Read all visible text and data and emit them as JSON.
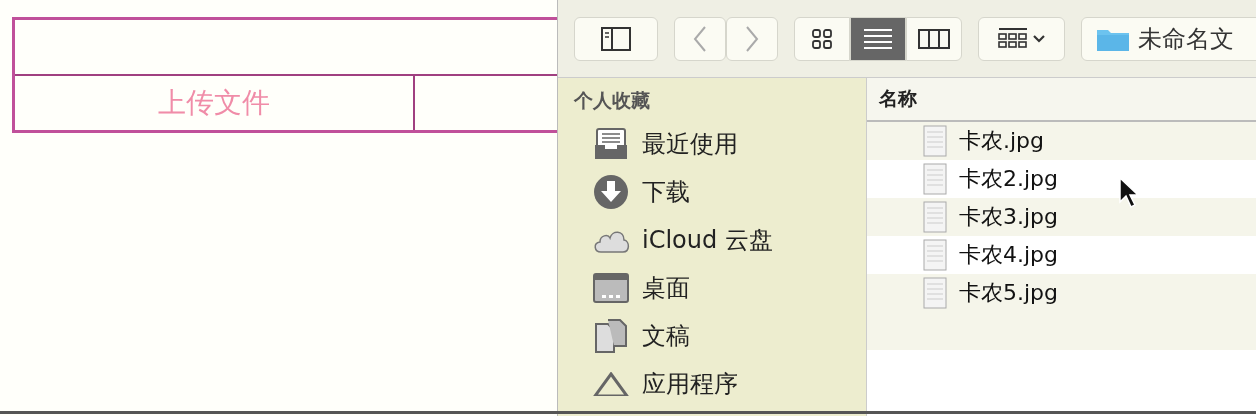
{
  "page_table": {
    "upload_label": "上传文件"
  },
  "dialog": {
    "toolbar": {
      "view_modes": [
        {
          "kind": "icons",
          "selected": false
        },
        {
          "kind": "list",
          "selected": true
        },
        {
          "kind": "columns",
          "selected": false
        }
      ],
      "path": "未命名文"
    },
    "sidebar": {
      "section": "个人收藏",
      "items": [
        {
          "kind": "recent",
          "label": "最近使用"
        },
        {
          "kind": "download",
          "label": "下载"
        },
        {
          "kind": "cloud",
          "label": "iCloud 云盘"
        },
        {
          "kind": "desktop",
          "label": "桌面"
        },
        {
          "kind": "documents",
          "label": "文稿"
        },
        {
          "kind": "apps",
          "label": "应用程序"
        }
      ]
    },
    "file_list": {
      "column": "名称",
      "files": [
        {
          "name": "卡农.jpg"
        },
        {
          "name": "卡农2.jpg"
        },
        {
          "name": "卡农3.jpg"
        },
        {
          "name": "卡农4.jpg"
        },
        {
          "name": "卡农5.jpg"
        }
      ]
    }
  }
}
